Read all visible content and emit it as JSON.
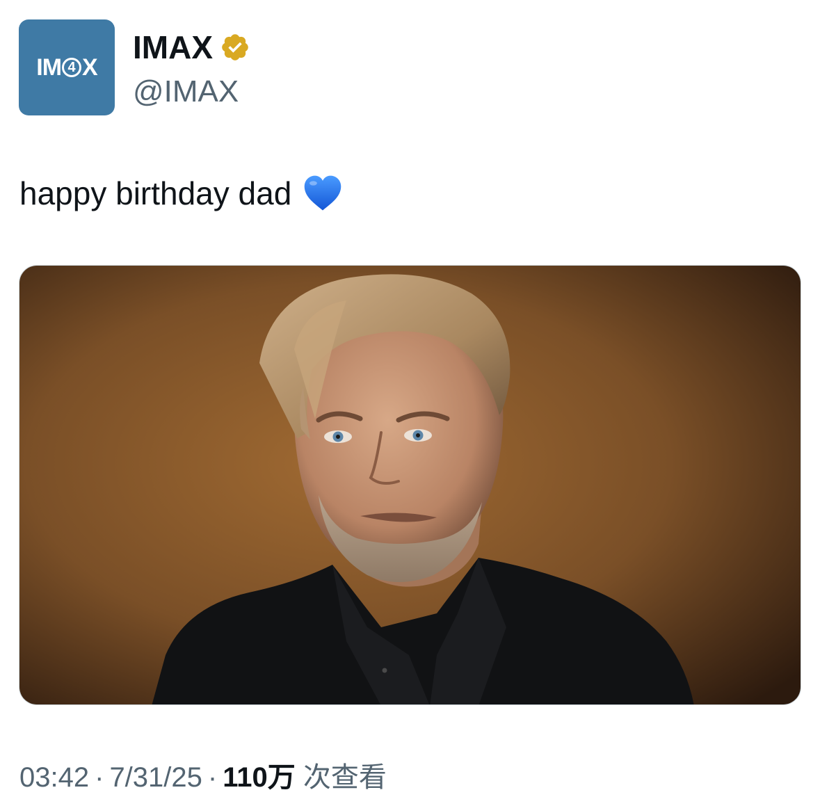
{
  "author": {
    "avatar_logo_left": "IM",
    "avatar_logo_digit": "4",
    "avatar_logo_right": "X",
    "display_name": "IMAX",
    "handle": "@IMAX",
    "verified_icon": "verified-badge-icon",
    "verified_color": "#d9a922"
  },
  "tweet": {
    "text": "happy birthday dad",
    "emoji_icon": "blue-heart-icon",
    "emoji_color": "#1d6ff2"
  },
  "media": {
    "alt": "portrait-photo"
  },
  "meta": {
    "time": "03:42",
    "separator": "·",
    "date": "7/31/25",
    "views_count": "110万",
    "views_label": "次查看"
  },
  "colors": {
    "avatar_bg": "#3f7aa5",
    "secondary_text": "#536471",
    "primary_text": "#0f1419"
  }
}
